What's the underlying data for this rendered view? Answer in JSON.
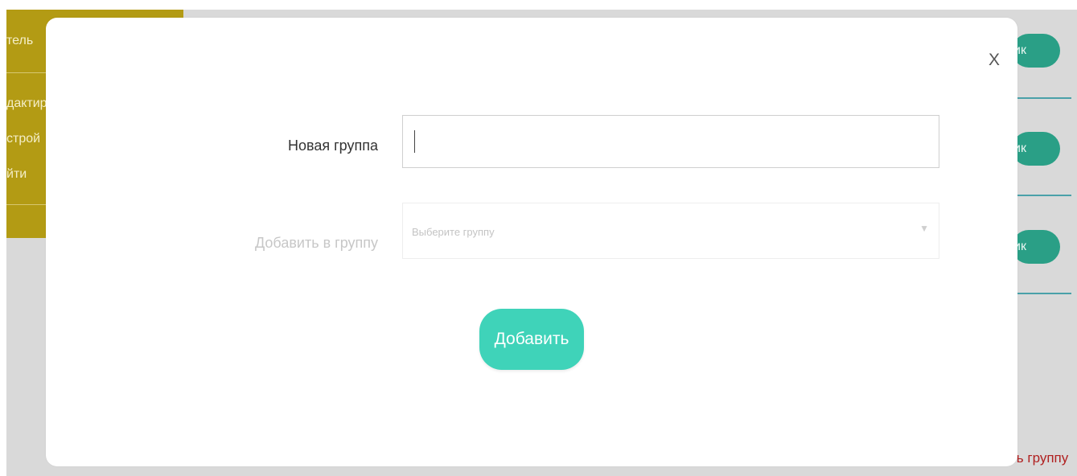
{
  "background": {
    "sidebar": {
      "items": [
        "тель",
        "дактир",
        "строй",
        "йти"
      ]
    },
    "row_buttons": [
      "ик",
      "ик",
      "ик"
    ],
    "footer_link": "ть группу"
  },
  "modal": {
    "close_label": "X",
    "new_group_label": "Новая группа",
    "new_group_value": "",
    "add_to_group_label": "Добавить в группу",
    "select_placeholder": "Выберите группу",
    "select_arrow": "▼",
    "submit_label": "Добавить"
  },
  "colors": {
    "accent": "#3fd3b9",
    "sidebar": "#b39b14",
    "danger_link": "#b02020"
  }
}
